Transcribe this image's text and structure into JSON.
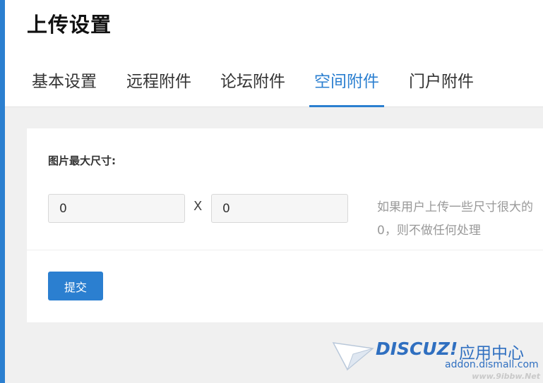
{
  "page": {
    "title": "上传设置"
  },
  "tabs": [
    {
      "label": "基本设置",
      "active": false
    },
    {
      "label": "远程附件",
      "active": false
    },
    {
      "label": "论坛附件",
      "active": false
    },
    {
      "label": "空间附件",
      "active": true
    },
    {
      "label": "门户附件",
      "active": false
    }
  ],
  "form": {
    "max_image_size_label": "图片最大尺寸:",
    "width_value": "0",
    "height_value": "0",
    "separator": "X",
    "hint_line1": "如果用户上传一些尺寸很大的",
    "hint_line2": "0，则不做任何处理",
    "submit_label": "提交"
  },
  "watermark": {
    "logo_text": "DISCUZ!",
    "cn_text": "应用中心",
    "url_text": "addon.dismall.com",
    "small_text": "www.9ibbw.Net"
  },
  "colors": {
    "accent": "#2b7fd0",
    "hint": "#999999"
  }
}
